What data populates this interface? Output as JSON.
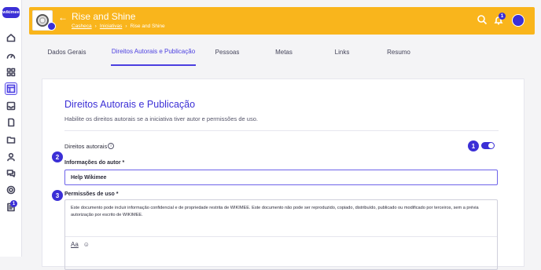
{
  "sidebar": {
    "logo": "wikimee",
    "badge": "1"
  },
  "topbar": {
    "title": "Rise and Shine",
    "back_icon": "←",
    "breadcrumbs": [
      "Casheca",
      "Iniciativas",
      "Rise and Shine"
    ],
    "crumb_sep": "›",
    "notifications": "1"
  },
  "tabs": [
    {
      "label": "Dados Gerais"
    },
    {
      "label": "Direitos Autorais e Publicação"
    },
    {
      "label": "Pessoas"
    },
    {
      "label": "Metas"
    },
    {
      "label": "Links"
    },
    {
      "label": "Resumo"
    }
  ],
  "section": {
    "title": "Direitos Autorais e Publicação",
    "subtitle": "Habilite os direitos autorais se a iniciativa tiver autor e permissões de uso.",
    "copyright_label": "Direitos autorais",
    "info_icon": "i",
    "author_label": "Informações do autor *",
    "author_value": "Help Wikimee",
    "permissions_label": "Permissões de uso *",
    "permissions_value": "Este documento pode incluir informação confidencial e de propriedade restrita de WIKIMEE. Este documento não pode ser reproduzido, copiado, distribuído, publicado ou modificado por terceiros, sem a prévia autorização por escrito de WIKIMEE.",
    "format_label": "Aa",
    "emoji_icon": "☺"
  },
  "steps": [
    "1",
    "2",
    "3"
  ],
  "colors": {
    "accent": "#3b2fd6",
    "topbar": "#f9b51c"
  }
}
